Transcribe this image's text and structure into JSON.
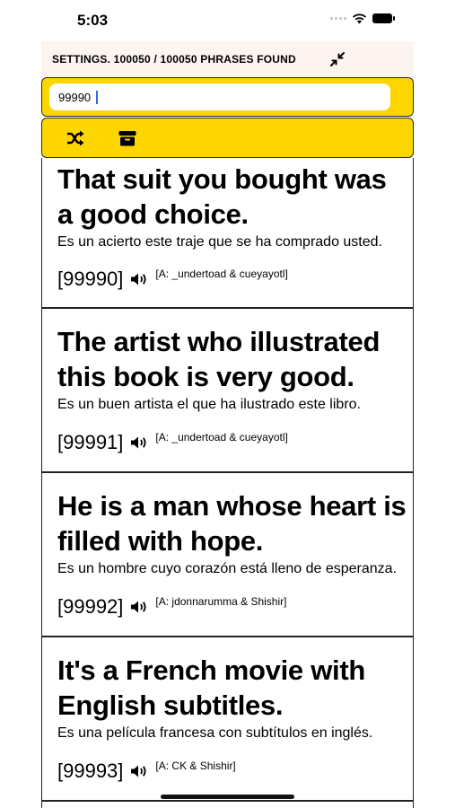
{
  "status_bar": {
    "time": "5:03"
  },
  "header": {
    "title": "SETTINGS. 100050 / 100050 PHRASES FOUND"
  },
  "search": {
    "value": "99990"
  },
  "toolbar": {
    "shuffle_icon": "shuffle-icon",
    "archive_icon": "archive-icon"
  },
  "colors": {
    "accent": "#fdd600",
    "header_bg": "#fdf4f0"
  },
  "phrases": [
    {
      "id": "[99990]",
      "phrase": "That suit you bought was a good choice.",
      "translation": "Es un acierto este traje que se ha comprado usted.",
      "attribution": "[A: _undertoad & cueyayotl]"
    },
    {
      "id": "[99991]",
      "phrase": "The artist who illustrated this book is very good.",
      "translation": "Es un buen artista el que ha ilustrado este libro.",
      "attribution": "[A: _undertoad & cueyayotl]"
    },
    {
      "id": "[99992]",
      "phrase": "He is a man whose heart is filled with hope.",
      "translation": "Es un hombre cuyo corazón está lleno de esperanza.",
      "attribution": "[A: jdonnarumma & Shishir]"
    },
    {
      "id": "[99993]",
      "phrase": "It's a French movie with English subtitles.",
      "translation": "Es una película francesa con subtítulos en inglés.",
      "attribution": "[A: CK & Shishir]"
    }
  ]
}
